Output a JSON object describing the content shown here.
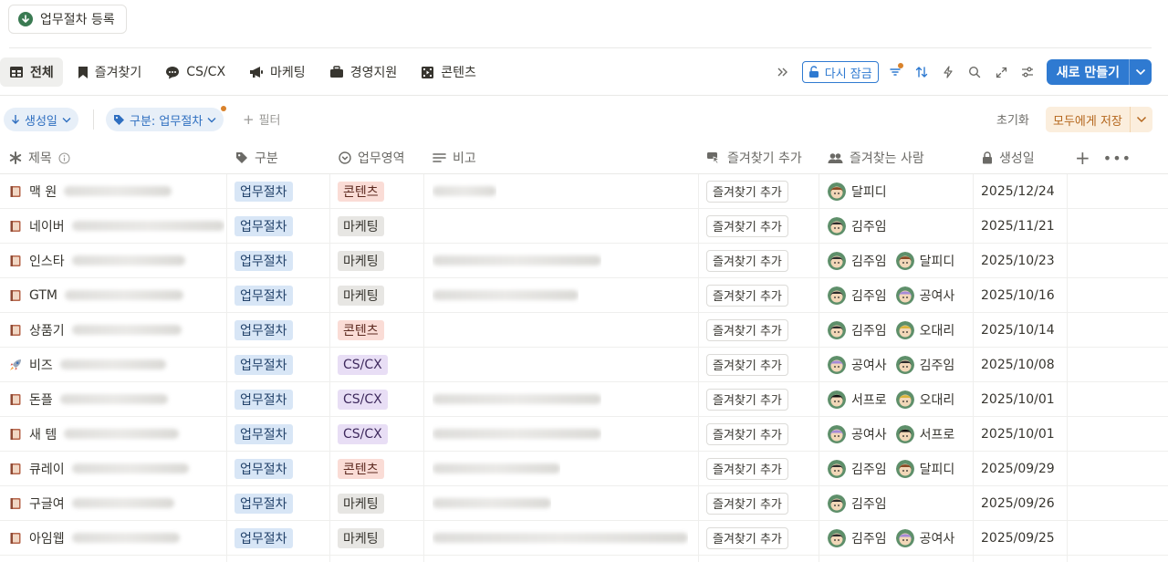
{
  "register_button": {
    "label": "업무절차 등록"
  },
  "tabs": [
    {
      "label": "전체",
      "icon": "table-icon",
      "active": true
    },
    {
      "label": "즐겨찾기",
      "icon": "bookmark-icon",
      "active": false
    },
    {
      "label": "CS/CX",
      "icon": "chat-bubble-icon",
      "active": false
    },
    {
      "label": "마케팅",
      "icon": "megaphone-icon",
      "active": false
    },
    {
      "label": "경영지원",
      "icon": "briefcase-icon",
      "active": false
    },
    {
      "label": "콘텐츠",
      "icon": "film-icon",
      "active": false
    }
  ],
  "toolbar": {
    "lock_label": "다시 잠금",
    "new_label": "새로 만들기",
    "icons": [
      "double-chevron-icon",
      "filter-lines-icon",
      "sort-arrows-icon",
      "lightning-icon",
      "search-icon",
      "expand-icon",
      "settings-sliders-icon"
    ]
  },
  "filters": {
    "sort_chip": "생성일",
    "category_chip": "구분: 업무절차",
    "add_filter": "필터",
    "reset": "초기화",
    "save": "모두에게 저장"
  },
  "columns": {
    "title": "제목",
    "category": "구분",
    "area": "업무영역",
    "note": "비고",
    "fav_add": "즐겨찾기 추가",
    "fav_people": "즐겨찾는 사람",
    "created": "생성일"
  },
  "colors": {
    "accent": "#2f7ad1",
    "save_bg": "#fbeedd",
    "save_text": "#b4661c"
  },
  "rows": [
    {
      "title": "맥 원",
      "icon": "book-icon",
      "category": "업무절차",
      "area": "콘텐츠",
      "area_color": "orange",
      "has_note": true,
      "fav_btn": "즐겨찾기 추가",
      "people": [
        {
          "name": "달피디",
          "avatar": "brown"
        }
      ],
      "date": "2025/12/24"
    },
    {
      "title": "네이버",
      "icon": "book-icon",
      "category": "업무절차",
      "area": "마케팅",
      "area_color": "gray",
      "has_note": false,
      "fav_btn": "즐겨찾기 추가",
      "people": [
        {
          "name": "김주임",
          "avatar": "dark"
        }
      ],
      "date": "2025/11/21"
    },
    {
      "title": "인스타",
      "icon": "book-icon",
      "category": "업무절차",
      "area": "마케팅",
      "area_color": "gray",
      "has_note": true,
      "fav_btn": "즐겨찾기 추가",
      "people": [
        {
          "name": "김주임",
          "avatar": "dark"
        },
        {
          "name": "달피디",
          "avatar": "brown"
        }
      ],
      "date": "2025/10/23"
    },
    {
      "title": "GTM",
      "icon": "book-icon",
      "category": "업무절차",
      "area": "마케팅",
      "area_color": "gray",
      "has_note": true,
      "fav_btn": "즐겨찾기 추가",
      "people": [
        {
          "name": "김주임",
          "avatar": "dark"
        },
        {
          "name": "공여사",
          "avatar": "purple"
        }
      ],
      "date": "2025/10/16"
    },
    {
      "title": "상품기",
      "icon": "book-icon",
      "category": "업무절차",
      "area": "콘텐츠",
      "area_color": "orange",
      "has_note": false,
      "fav_btn": "즐겨찾기 추가",
      "people": [
        {
          "name": "김주임",
          "avatar": "dark"
        },
        {
          "name": "오대리",
          "avatar": "yellow"
        }
      ],
      "date": "2025/10/14"
    },
    {
      "title": "비즈",
      "icon": "rocket-icon",
      "category": "업무절차",
      "area": "CS/CX",
      "area_color": "purple",
      "has_note": false,
      "fav_btn": "즐겨찾기 추가",
      "people": [
        {
          "name": "공여사",
          "avatar": "purple"
        },
        {
          "name": "김주임",
          "avatar": "dark"
        }
      ],
      "date": "2025/10/08"
    },
    {
      "title": "돈플",
      "icon": "book-icon",
      "category": "업무절차",
      "area": "CS/CX",
      "area_color": "purple",
      "has_note": true,
      "fav_btn": "즐겨찾기 추가",
      "people": [
        {
          "name": "서프로",
          "avatar": "black"
        },
        {
          "name": "오대리",
          "avatar": "yellow"
        }
      ],
      "date": "2025/10/01"
    },
    {
      "title": "새 템",
      "icon": "book-icon",
      "category": "업무절차",
      "area": "CS/CX",
      "area_color": "purple",
      "has_note": true,
      "fav_btn": "즐겨찾기 추가",
      "people": [
        {
          "name": "공여사",
          "avatar": "purple"
        },
        {
          "name": "서프로",
          "avatar": "black"
        }
      ],
      "date": "2025/10/01"
    },
    {
      "title": "큐레이",
      "icon": "book-icon",
      "category": "업무절차",
      "area": "콘텐츠",
      "area_color": "orange",
      "has_note": true,
      "fav_btn": "즐겨찾기 추가",
      "people": [
        {
          "name": "김주임",
          "avatar": "dark"
        },
        {
          "name": "달피디",
          "avatar": "brown"
        }
      ],
      "date": "2025/09/29"
    },
    {
      "title": "구글여",
      "icon": "book-icon",
      "category": "업무절차",
      "area": "마케팅",
      "area_color": "gray",
      "has_note": true,
      "fav_btn": "즐겨찾기 추가",
      "people": [
        {
          "name": "김주임",
          "avatar": "dark"
        }
      ],
      "date": "2025/09/26"
    },
    {
      "title": "아임웹",
      "icon": "book-icon",
      "category": "업무절차",
      "area": "마케팅",
      "area_color": "gray",
      "has_note": true,
      "fav_btn": "즐겨찾기 추가",
      "people": [
        {
          "name": "김주임",
          "avatar": "dark"
        },
        {
          "name": "공여사",
          "avatar": "purple"
        }
      ],
      "date": "2025/09/25"
    }
  ]
}
